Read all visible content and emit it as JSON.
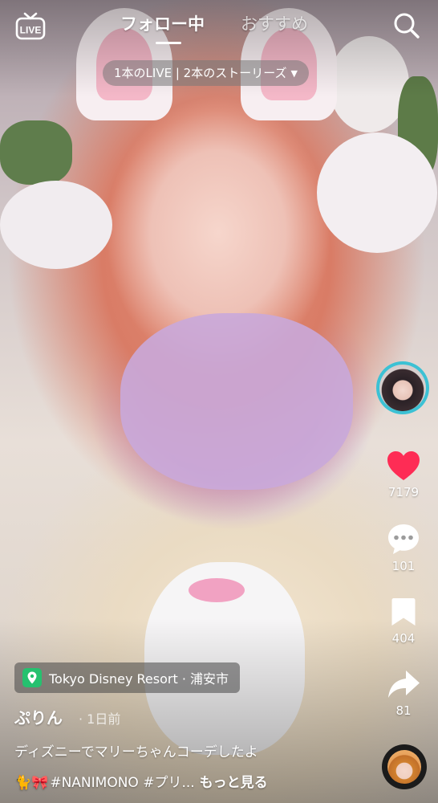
{
  "top_bar": {
    "live_label": "LIVE",
    "tabs": [
      {
        "label": "フォロー中",
        "active": true
      },
      {
        "label": "おすすめ",
        "active": false
      }
    ],
    "search_icon": "search-icon"
  },
  "live_banner": {
    "text": "1本のLIVE | 2本のストーリーズ"
  },
  "actions": {
    "likes": "7179",
    "comments": "101",
    "saves": "404",
    "shares": "81"
  },
  "location": {
    "text": "Tokyo Disney Resort · 浦安市"
  },
  "post": {
    "author": "ぷりん",
    "time": "· 1日前",
    "caption": "ディズニーでマリーちゃんコーデしたよ",
    "tags_emoji": "🐈🎀",
    "tags": "#NANIMONO #プリ...",
    "see_more": "もっと見る"
  },
  "colors": {
    "like_red": "#fe2c55",
    "avatar_ring": "#3cc1d4",
    "location_pin": "#25c16f"
  }
}
